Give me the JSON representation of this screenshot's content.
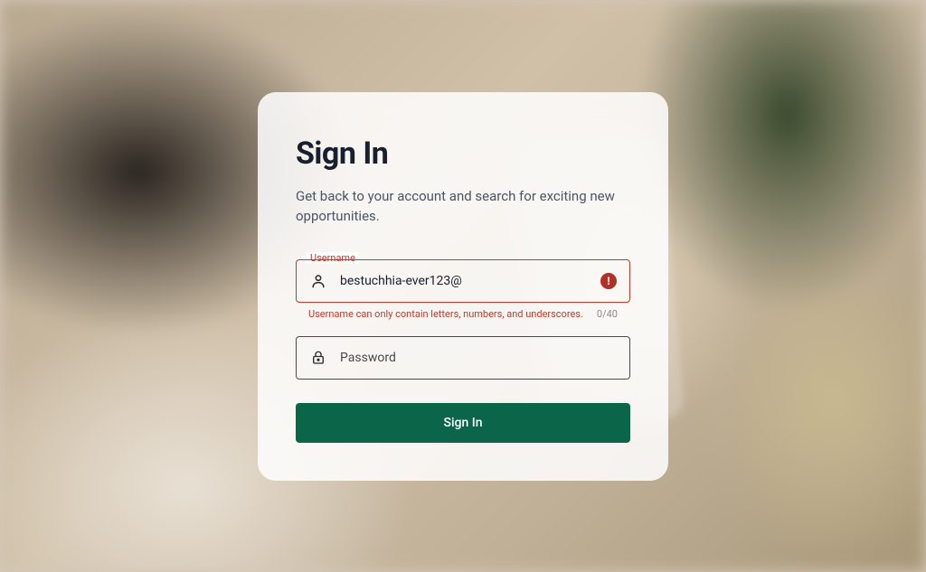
{
  "card": {
    "title": "Sign In",
    "subtitle": "Get back to your account and search for exciting new opportunities."
  },
  "username_field": {
    "label": "Username",
    "value": "bestuchhia-ever123@",
    "error_message": "Username can only contain letters, numbers, and underscores.",
    "char_count": "0/40"
  },
  "password_field": {
    "placeholder": "Password"
  },
  "submit": {
    "label": "Sign In"
  }
}
